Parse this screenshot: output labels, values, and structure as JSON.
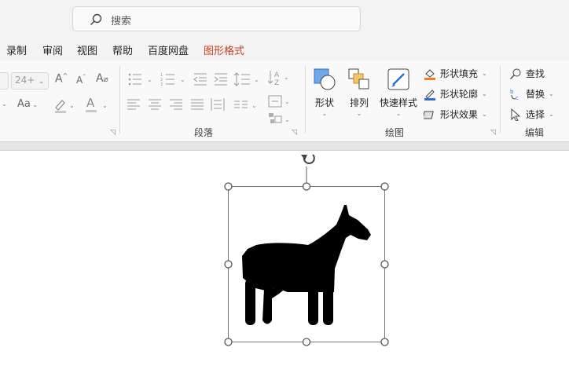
{
  "search": {
    "placeholder": "搜索"
  },
  "tabs": [
    {
      "label": "录制"
    },
    {
      "label": "审阅"
    },
    {
      "label": "视图"
    },
    {
      "label": "帮助"
    },
    {
      "label": "百度网盘"
    },
    {
      "label": "图形格式"
    }
  ],
  "font": {
    "size": "24+"
  },
  "groups": {
    "paragraph": {
      "label": "段落"
    },
    "drawing": {
      "label": "绘图",
      "shapes_label": "形状",
      "arrange_label": "排列",
      "quick_styles_label": "快速样式",
      "fill_label": "形状填充",
      "outline_label": "形状轮廓",
      "effects_label": "形状效果"
    },
    "editing": {
      "label": "编辑",
      "find_label": "查找",
      "replace_label": "替换",
      "select_label": "选择"
    }
  },
  "colors": {
    "accent": "#c43e1c",
    "fill_bar": "#f07c26",
    "outline_bar": "#2f6fd1"
  },
  "icons": [
    "search-icon",
    "horse-icon",
    "rotate-handle-icon"
  ]
}
